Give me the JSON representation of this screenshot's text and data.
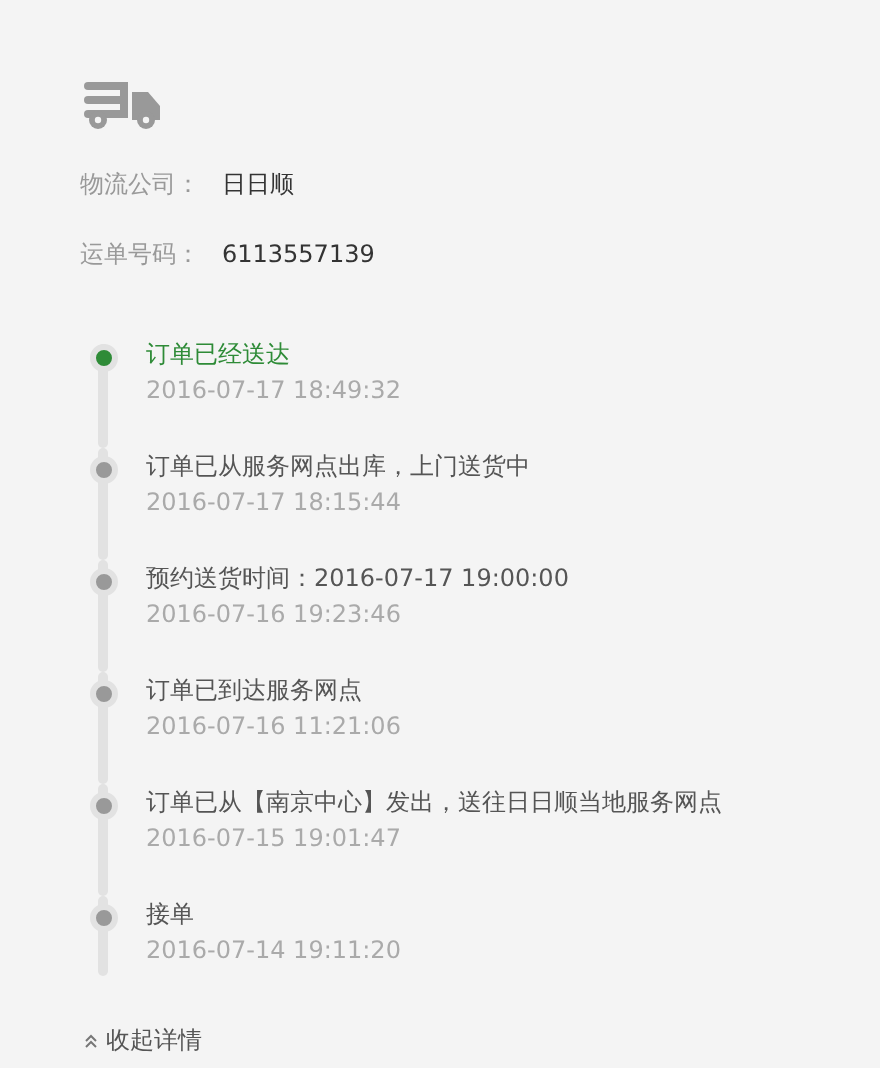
{
  "info": [
    {
      "label": "物流公司：",
      "value": "日日顺"
    },
    {
      "label": "运单号码：",
      "value": "6113557139"
    }
  ],
  "timeline": [
    {
      "text": "订单已经送达",
      "time": "2016-07-17 18:49:32",
      "current": true
    },
    {
      "text": "订单已从服务网点出库，上门送货中",
      "time": "2016-07-17 18:15:44",
      "current": false
    },
    {
      "text": "预约送货时间：2016-07-17 19:00:00",
      "time": "2016-07-16 19:23:46",
      "current": false
    },
    {
      "text": "订单已到达服务网点",
      "time": "2016-07-16 11:21:06",
      "current": false
    },
    {
      "text": "订单已从【南京中心】发出，送往日日顺当地服务网点",
      "time": "2016-07-15 19:01:47",
      "current": false
    },
    {
      "text": "接单",
      "time": "2016-07-14 19:11:20",
      "current": false
    }
  ],
  "collapse": {
    "label": "收起详情"
  }
}
